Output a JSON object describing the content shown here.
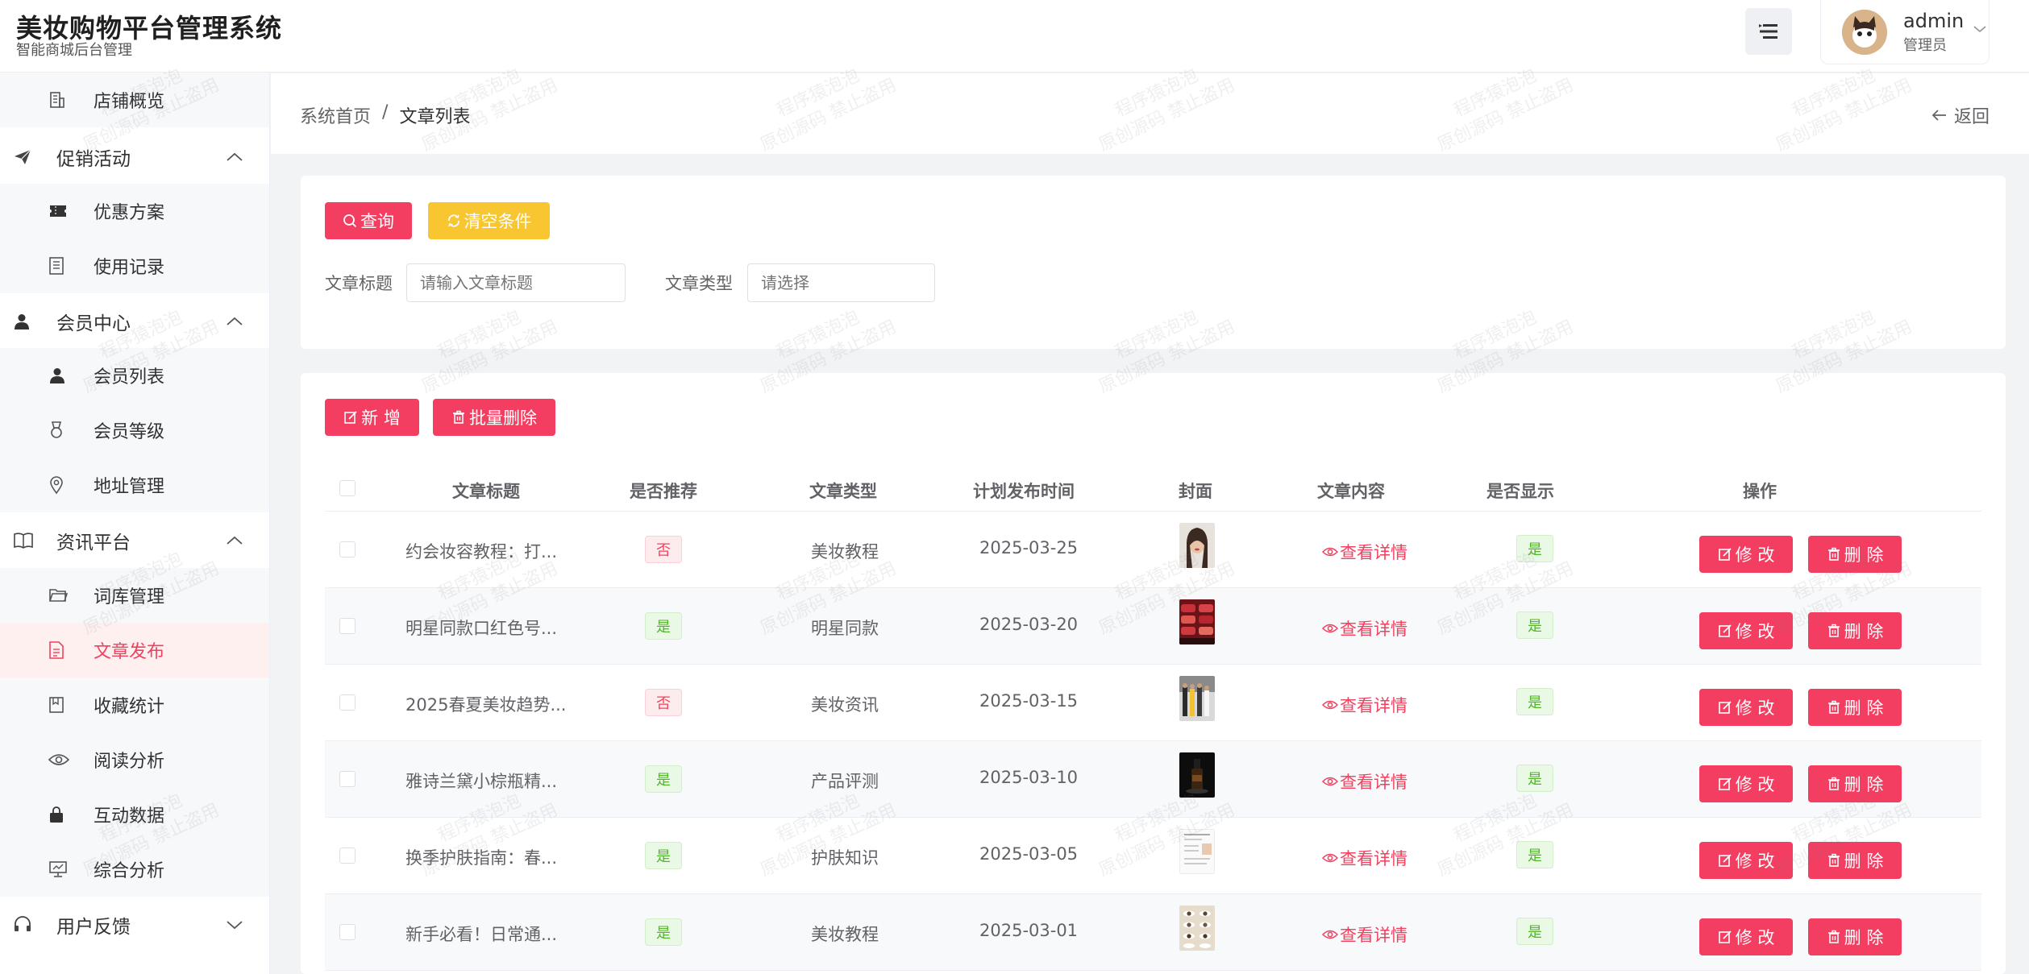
{
  "app": {
    "title": "美妆购物平台管理系统",
    "subtitle": "智能商城后台管理"
  },
  "user": {
    "name": "admin",
    "role": "管理员"
  },
  "sidebar": {
    "items": [
      {
        "type": "sub",
        "label": "店铺概览",
        "icon": "building-icon"
      },
      {
        "type": "group",
        "label": "促销活动",
        "icon": "send-icon",
        "expanded": true
      },
      {
        "type": "sub",
        "label": "优惠方案",
        "icon": "ticket-icon"
      },
      {
        "type": "sub",
        "label": "使用记录",
        "icon": "document-icon"
      },
      {
        "type": "group",
        "label": "会员中心",
        "icon": "user-icon",
        "expanded": true
      },
      {
        "type": "sub",
        "label": "会员列表",
        "icon": "user-icon"
      },
      {
        "type": "sub",
        "label": "会员等级",
        "icon": "medal-icon"
      },
      {
        "type": "sub",
        "label": "地址管理",
        "icon": "location-icon"
      },
      {
        "type": "group",
        "label": "资讯平台",
        "icon": "book-icon",
        "expanded": true
      },
      {
        "type": "sub",
        "label": "词库管理",
        "icon": "folder-icon"
      },
      {
        "type": "sub",
        "label": "文章发布",
        "icon": "article-icon",
        "active": true
      },
      {
        "type": "sub",
        "label": "收藏统计",
        "icon": "collection-icon"
      },
      {
        "type": "sub",
        "label": "阅读分析",
        "icon": "eye-icon"
      },
      {
        "type": "sub",
        "label": "互动数据",
        "icon": "lock-icon"
      },
      {
        "type": "sub",
        "label": "综合分析",
        "icon": "presentation-icon"
      },
      {
        "type": "group",
        "label": "用户反馈",
        "icon": "headset-icon",
        "expanded": false
      }
    ]
  },
  "breadcrumb": {
    "home": "系统首页",
    "separator": "/",
    "current": "文章列表",
    "back": "返回"
  },
  "search": {
    "query_button": "查询",
    "reset_button": "清空条件",
    "title_label": "文章标题",
    "title_placeholder": "请输入文章标题",
    "type_label": "文章类型",
    "type_placeholder": "请选择"
  },
  "toolbar": {
    "add_button": "新 增",
    "batch_delete_button": "批量删除"
  },
  "table": {
    "columns": [
      "文章标题",
      "是否推荐",
      "文章类型",
      "计划发布时间",
      "封面",
      "文章内容",
      "是否显示",
      "操作"
    ],
    "detail_link": "查看详情",
    "edit_button": "修 改",
    "delete_button": "删 除",
    "rows": [
      {
        "title": "约会妆容教程：打...",
        "recommend": "否",
        "type": "美妆教程",
        "date": "2025-03-25",
        "cover": "portrait",
        "visible": "是"
      },
      {
        "title": "明星同款口红色号...",
        "recommend": "是",
        "type": "明星同款",
        "date": "2025-03-20",
        "cover": "lipsticks",
        "visible": "是"
      },
      {
        "title": "2025春夏美妆趋势...",
        "recommend": "否",
        "type": "美妆资讯",
        "date": "2025-03-15",
        "cover": "fashion",
        "visible": "是"
      },
      {
        "title": "雅诗兰黛小棕瓶精...",
        "recommend": "是",
        "type": "产品评测",
        "date": "2025-03-10",
        "cover": "bottle",
        "visible": "是"
      },
      {
        "title": "换季护肤指南：春...",
        "recommend": "是",
        "type": "护肤知识",
        "date": "2025-03-05",
        "cover": "document",
        "visible": "是"
      },
      {
        "title": "新手必看！日常通...",
        "recommend": "是",
        "type": "美妆教程",
        "date": "2025-03-01",
        "cover": "eyes",
        "visible": "是"
      }
    ]
  },
  "watermark": {
    "line1": "程序猿泡泡",
    "line2": "原创源码 禁止盗用"
  },
  "colors": {
    "accent": "#f33e61",
    "warning": "#f7c631",
    "success": "#52b52b"
  }
}
